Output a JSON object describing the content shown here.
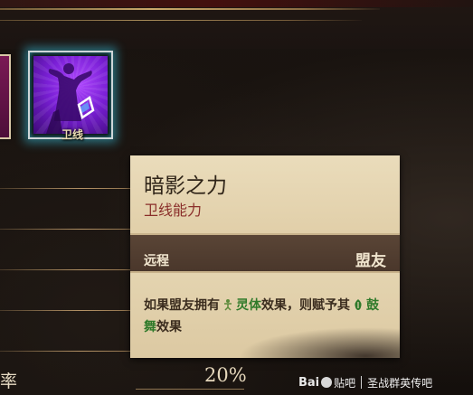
{
  "ability": {
    "label": "卫线",
    "icon": "defensive-stance-icon"
  },
  "tooltip": {
    "title": "暗影之力",
    "subtitle": "卫线能力",
    "range": "远程",
    "target": "盟友",
    "desc_part1": "如果盟友拥有",
    "keyword1": "灵体",
    "desc_part2": "效果，则赋予其",
    "keyword2": "鼓舞",
    "desc_part3": "效果"
  },
  "stat": {
    "label": "率",
    "value": "20%"
  },
  "watermark": {
    "logo": "Bai",
    "tieba": "贴吧",
    "forum": "圣战群英传吧"
  },
  "colors": {
    "keyword": "#2f7a2a",
    "glow": "#3cdcff",
    "subtitle": "#8a2e2a"
  }
}
